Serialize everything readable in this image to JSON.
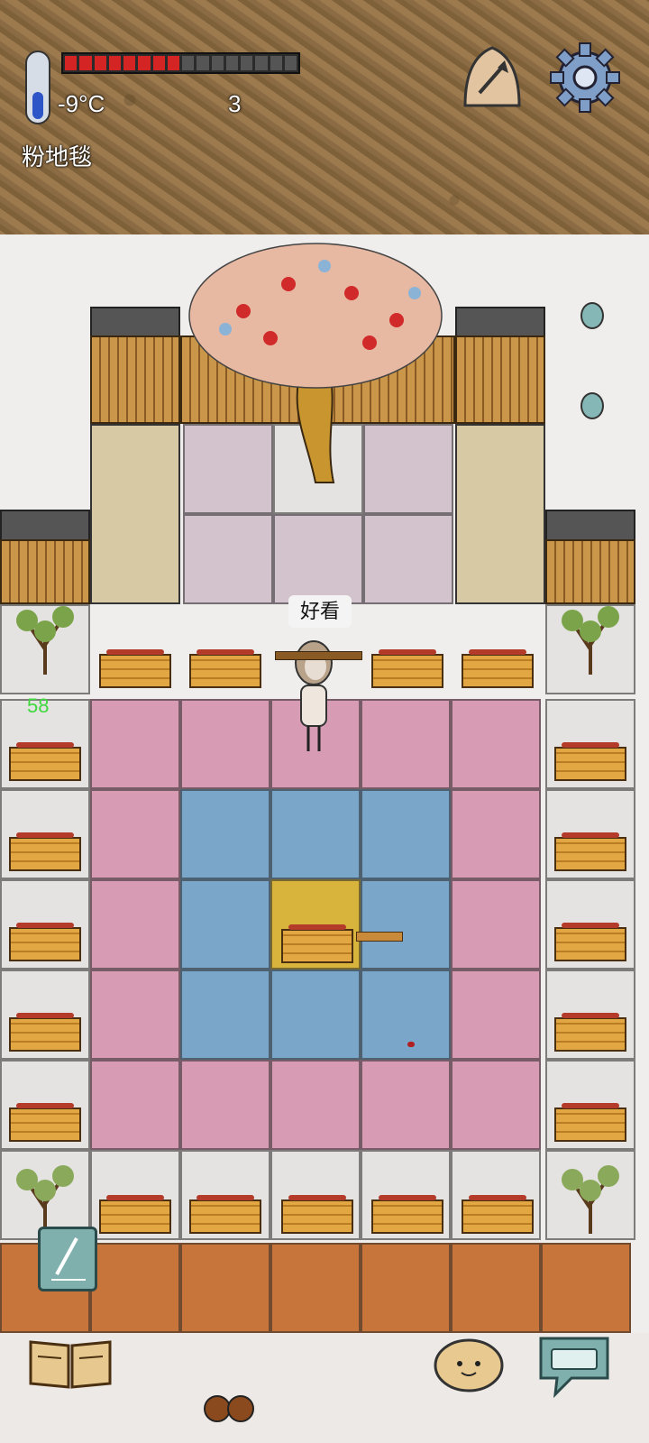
{
  "hud": {
    "temperature": "-9°C",
    "count": "3",
    "tile_label": "粉地毯",
    "health_fraction": 0.5
  },
  "world": {
    "speech_bubble": "好看",
    "floating_number": "58"
  },
  "icons": {
    "thermometer": "thermometer-icon",
    "compass": "compass-icon",
    "settings": "gear-icon",
    "pencil": "pencil-icon",
    "book": "book-icon",
    "emote": "potato-face-icon",
    "keyboard": "keyboard-icon"
  },
  "colors": {
    "health_on": "#d42424",
    "health_off": "#555555",
    "counter_green": "#3fd93f"
  }
}
